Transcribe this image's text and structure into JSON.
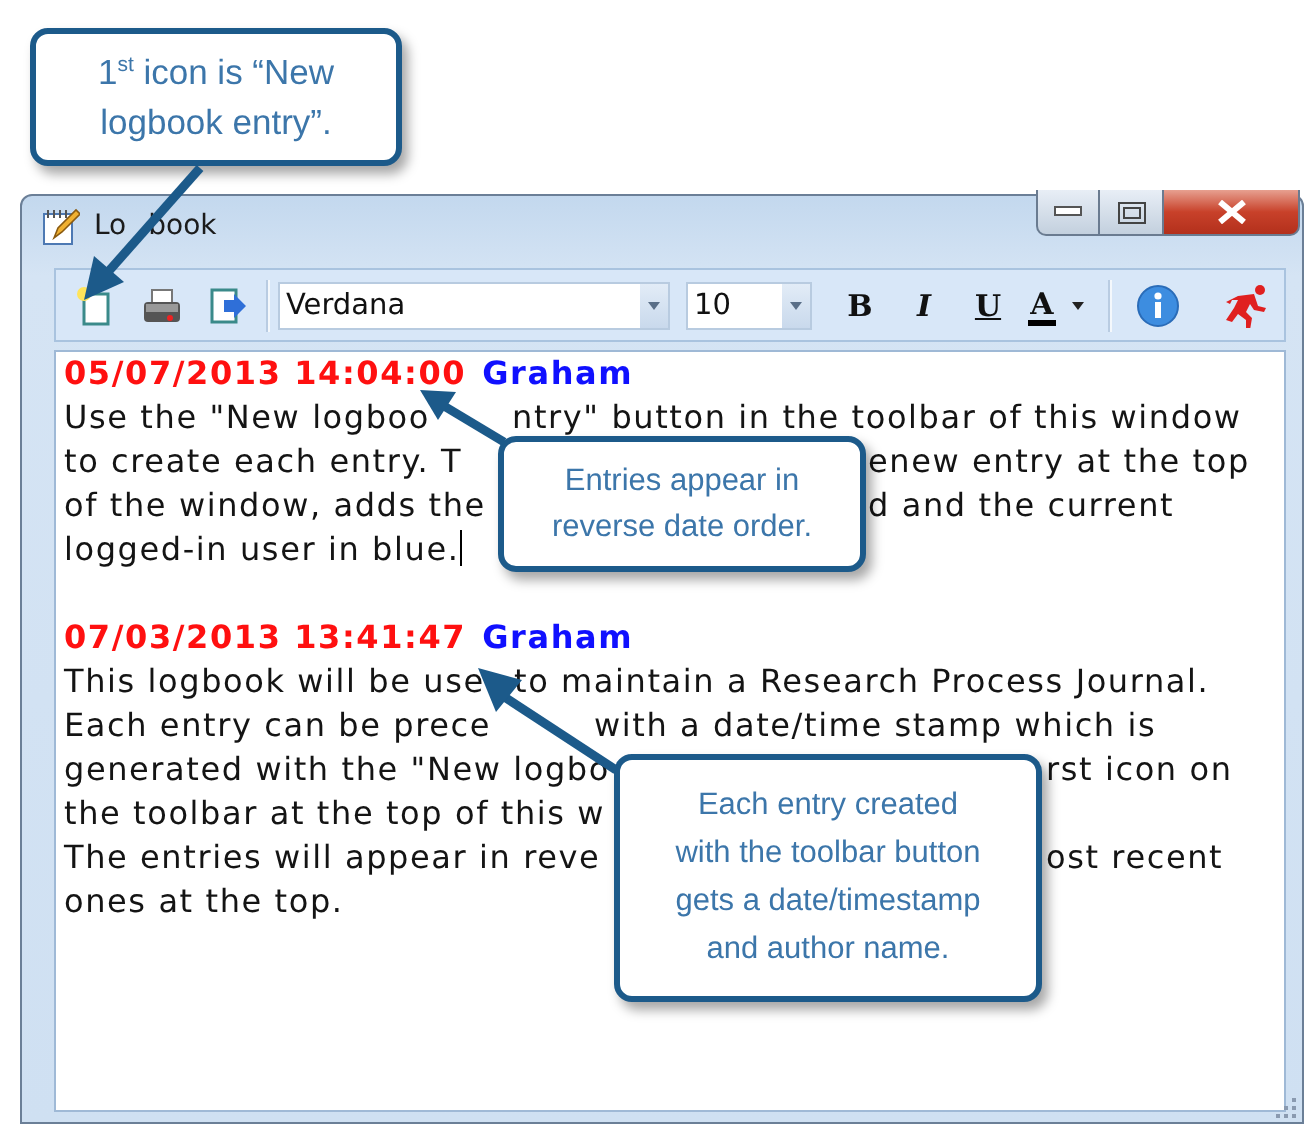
{
  "window": {
    "title": [
      "Lo",
      "book"
    ]
  },
  "toolbar": {
    "font": "Verdana",
    "size": "10",
    "format_buttons": [
      {
        "label": "B",
        "kind": "bold"
      },
      {
        "label": "I",
        "kind": "italic"
      },
      {
        "label": "U",
        "kind": "underline"
      },
      {
        "label": "A",
        "kind": "color"
      }
    ]
  },
  "entries": [
    {
      "timestamp": "05/07/2013 14:04:00",
      "author": "Graham",
      "cursor": true,
      "lines": [
        [
          "Use the \"New logboo",
          "ntry\" button in the toolbar of this window"
        ],
        [
          "to create each entry. T",
          "enew entry at the top"
        ],
        [
          "of the window, adds the",
          "d and the current"
        ],
        [
          "logged-in user in blue."
        ]
      ]
    },
    {
      "timestamp": "07/03/2013 13:41:47",
      "author": "Graham",
      "cursor": false,
      "lines": [
        [
          "This logbook will be use",
          "to maintain a Research Process Journal."
        ],
        [
          "Each entry can be prece",
          "with a date/time stamp which is"
        ],
        [
          "generated with the \"New logbo",
          "rst icon on"
        ],
        [
          "the toolbar at the top of this w"
        ],
        [
          "The entries will appear in reve",
          "ost recent"
        ],
        [
          "ones at the top."
        ]
      ]
    }
  ],
  "callouts": [
    {
      "text": "1$^{st}$ icon is “New logbook entry”."
    },
    {
      "text": "Entries appear in reverse date order."
    },
    {
      "text": "Each entry created with the toolbar button gets a date/timestamp and author name."
    }
  ]
}
